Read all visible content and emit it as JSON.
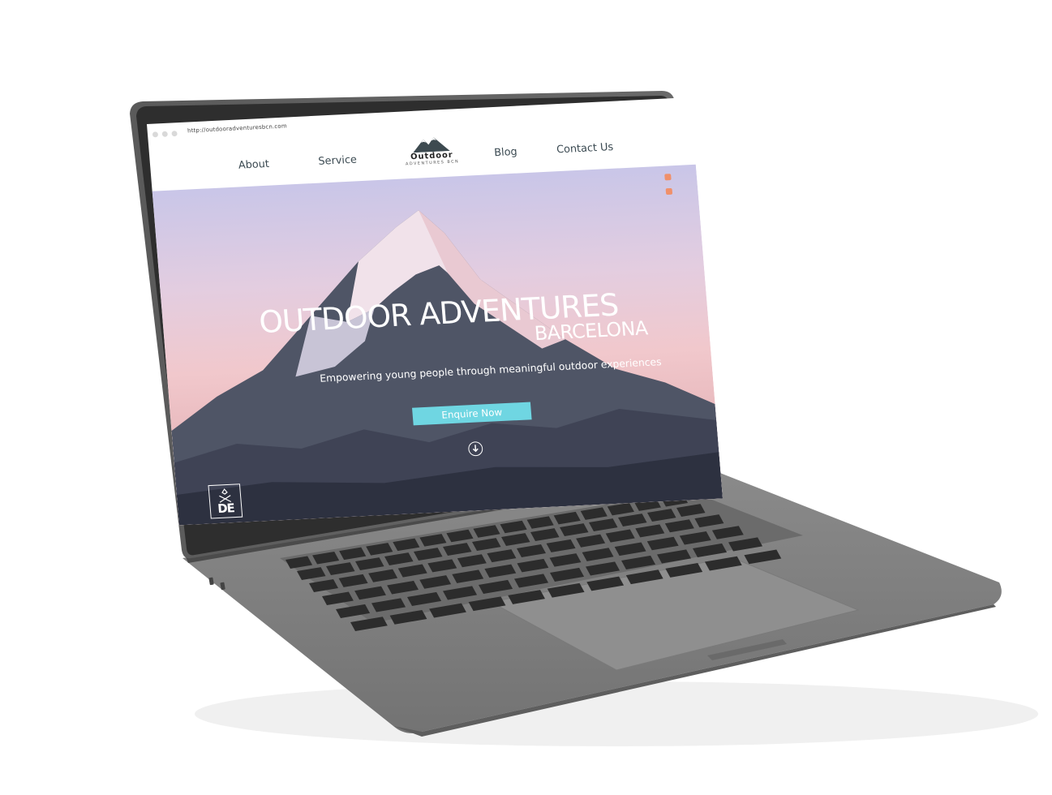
{
  "browser": {
    "url": "http://outdooradventuresbcn.com"
  },
  "nav": {
    "items": [
      {
        "label": "About"
      },
      {
        "label": "Service"
      },
      {
        "label": "Blog"
      },
      {
        "label": "Contact Us"
      }
    ]
  },
  "logo": {
    "title": "Outdoor",
    "subtitle": "ADVENTURES BCN"
  },
  "hero": {
    "title": "OUTDOOR ADVENTURES",
    "subtitle": "BARCELONA",
    "tagline": "Empowering young people through meaningful outdoor experiences",
    "cta_label": "Enquire Now",
    "badge_text": "DE"
  },
  "social_icons": [
    "instagram-icon",
    "facebook-icon",
    "linkedin-icon"
  ],
  "colors": {
    "accent": "#6fd6e2",
    "social": "#f0906a",
    "nav_text": "#3b4a52",
    "laptop_body": "#7d7d7d",
    "bezel": "#2e2e2e"
  }
}
